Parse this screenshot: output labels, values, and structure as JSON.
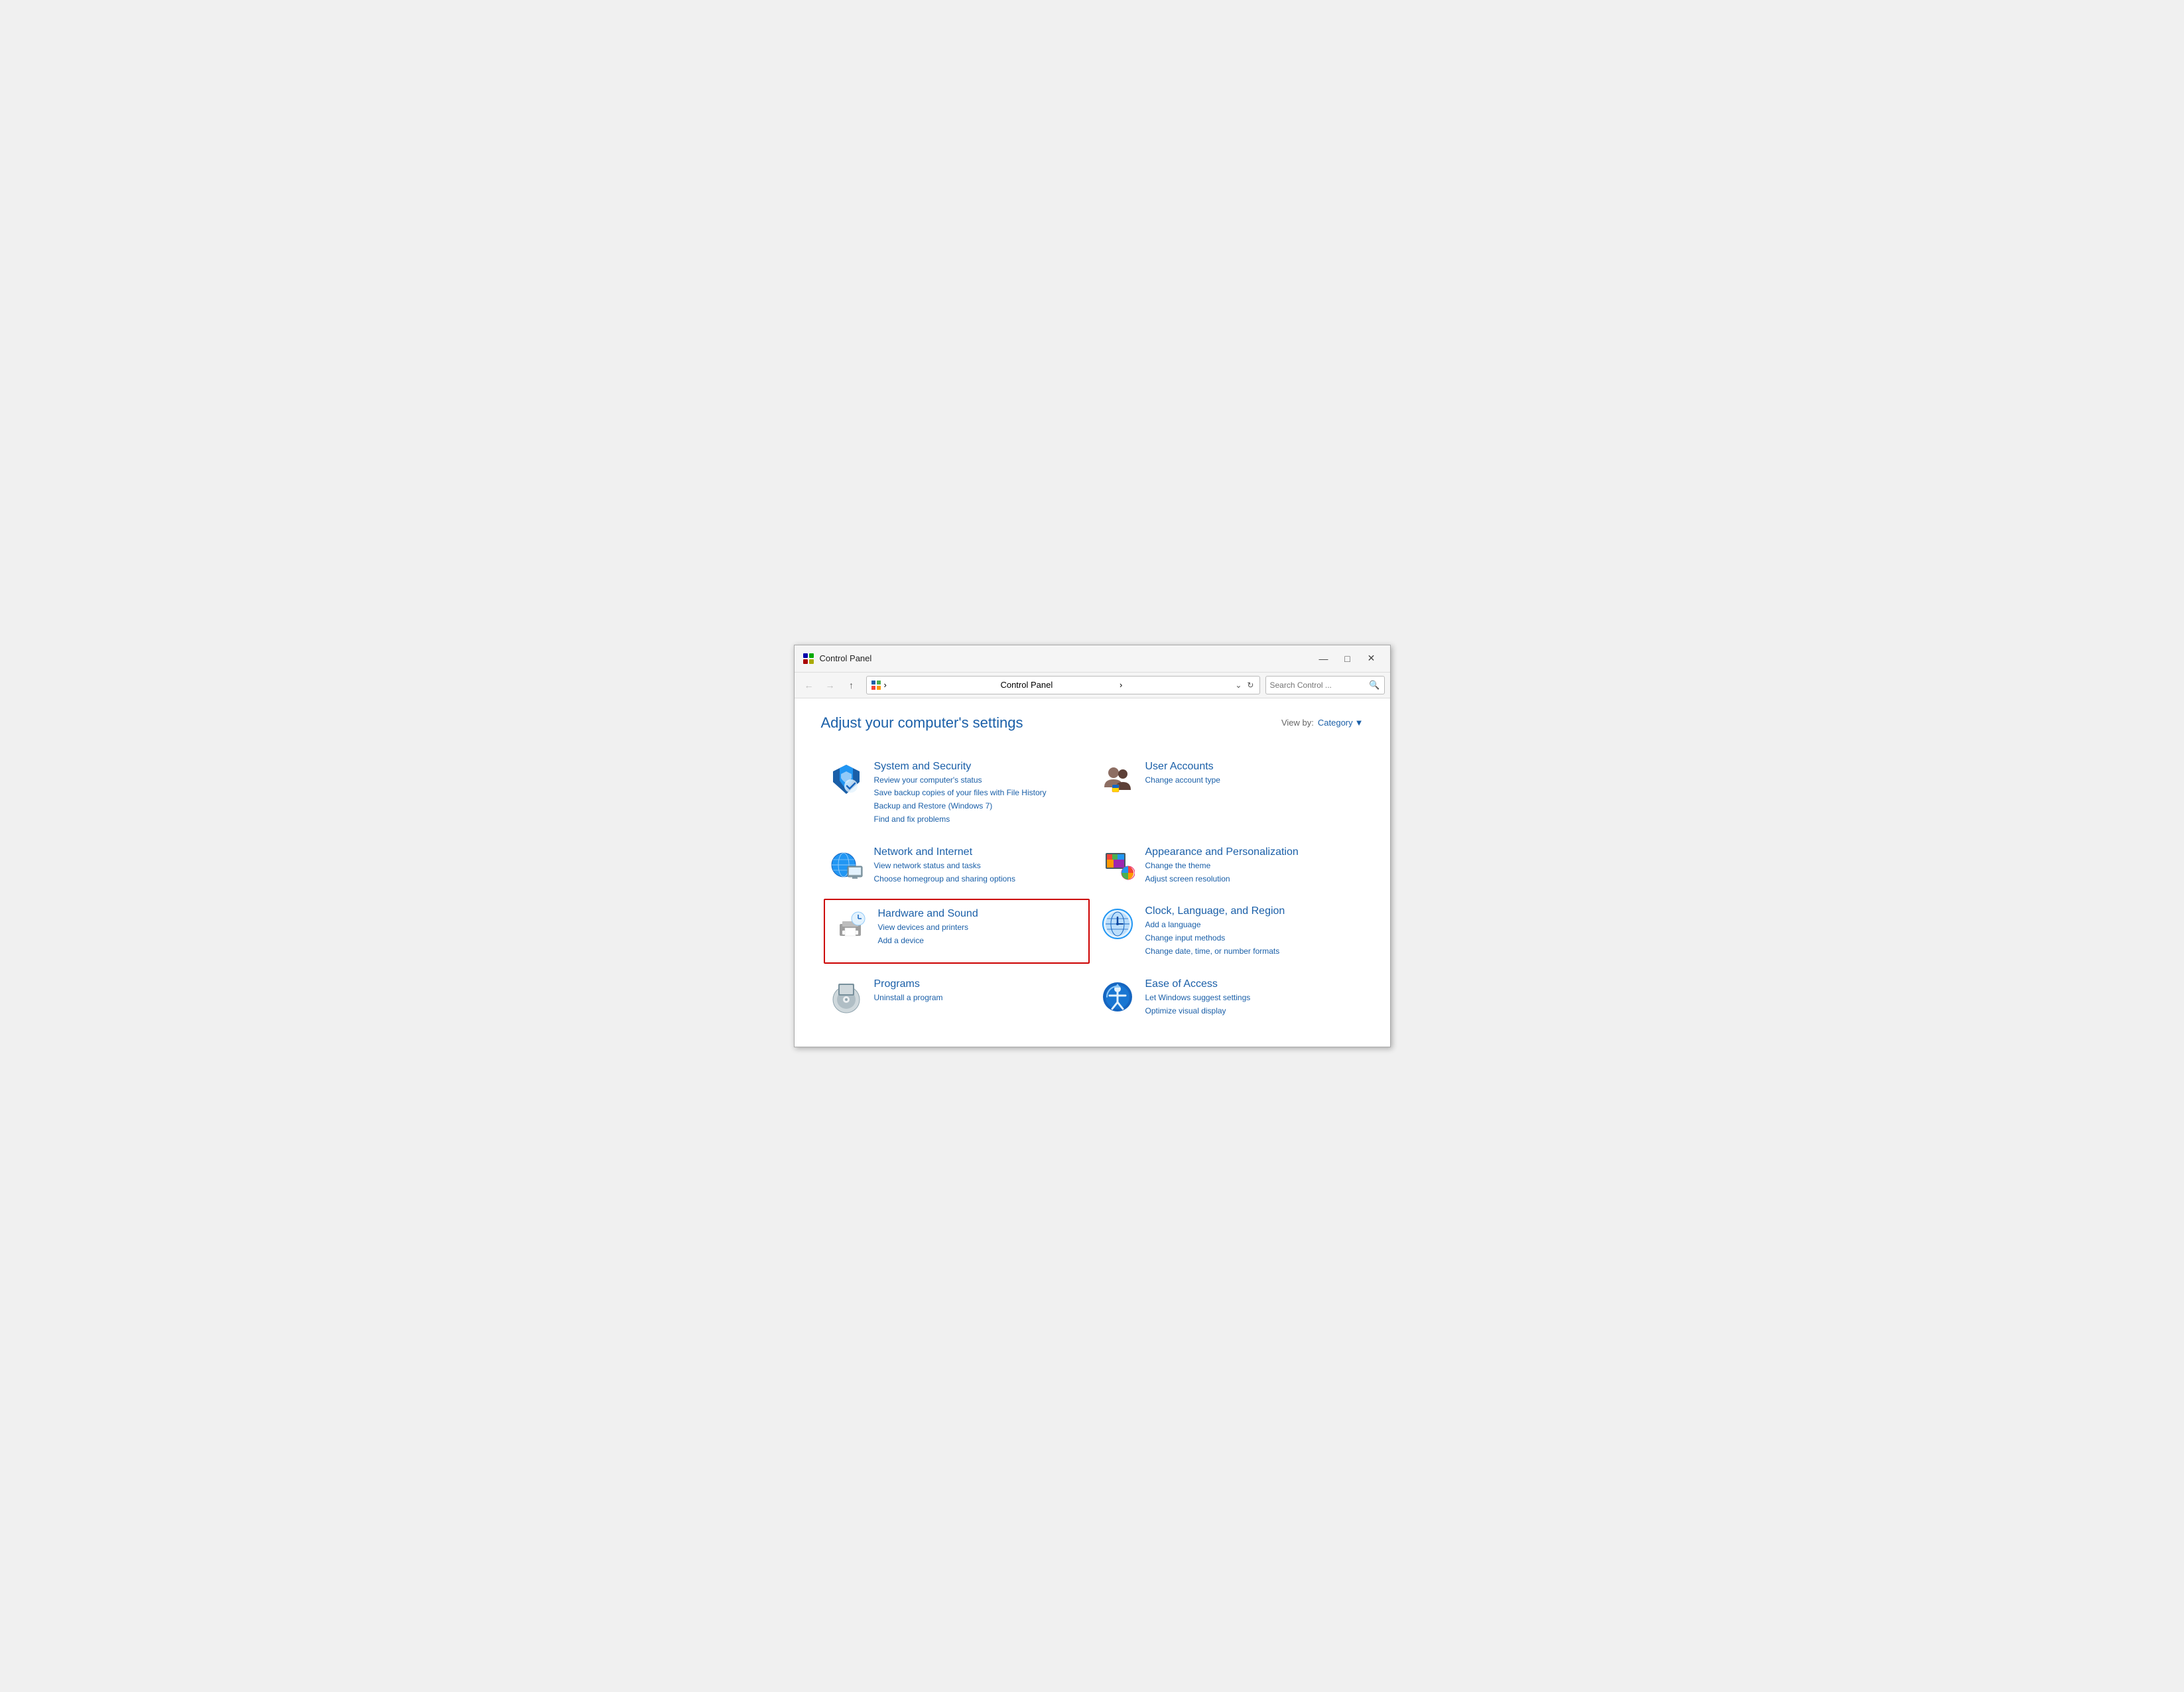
{
  "window": {
    "title": "Control Panel",
    "min_btn": "—",
    "max_btn": "□",
    "close_btn": "✕"
  },
  "toolbar": {
    "back_disabled": true,
    "forward_disabled": true,
    "up_label": "↑",
    "address": "Control Panel",
    "search_placeholder": "Search Control ...",
    "search_icon": "🔍"
  },
  "header": {
    "title": "Adjust your computer's settings",
    "viewby_label": "View by:",
    "viewby_value": "Category"
  },
  "categories": [
    {
      "id": "system-security",
      "title": "System and Security",
      "links": [
        "Review your computer's status",
        "Save backup copies of your files with File History",
        "Backup and Restore (Windows 7)",
        "Find and fix problems"
      ],
      "highlighted": false
    },
    {
      "id": "user-accounts",
      "title": "User Accounts",
      "links": [
        "Change account type"
      ],
      "highlighted": false
    },
    {
      "id": "network-internet",
      "title": "Network and Internet",
      "links": [
        "View network status and tasks",
        "Choose homegroup and sharing options"
      ],
      "highlighted": false
    },
    {
      "id": "appearance-personalization",
      "title": "Appearance and Personalization",
      "links": [
        "Change the theme",
        "Adjust screen resolution"
      ],
      "highlighted": false
    },
    {
      "id": "hardware-sound",
      "title": "Hardware and Sound",
      "links": [
        "View devices and printers",
        "Add a device"
      ],
      "highlighted": true
    },
    {
      "id": "clock-language-region",
      "title": "Clock, Language, and Region",
      "links": [
        "Add a language",
        "Change input methods",
        "Change date, time, or number formats"
      ],
      "highlighted": false
    },
    {
      "id": "programs",
      "title": "Programs",
      "links": [
        "Uninstall a program"
      ],
      "highlighted": false
    },
    {
      "id": "ease-of-access",
      "title": "Ease of Access",
      "links": [
        "Let Windows suggest settings",
        "Optimize visual display"
      ],
      "highlighted": false
    }
  ]
}
